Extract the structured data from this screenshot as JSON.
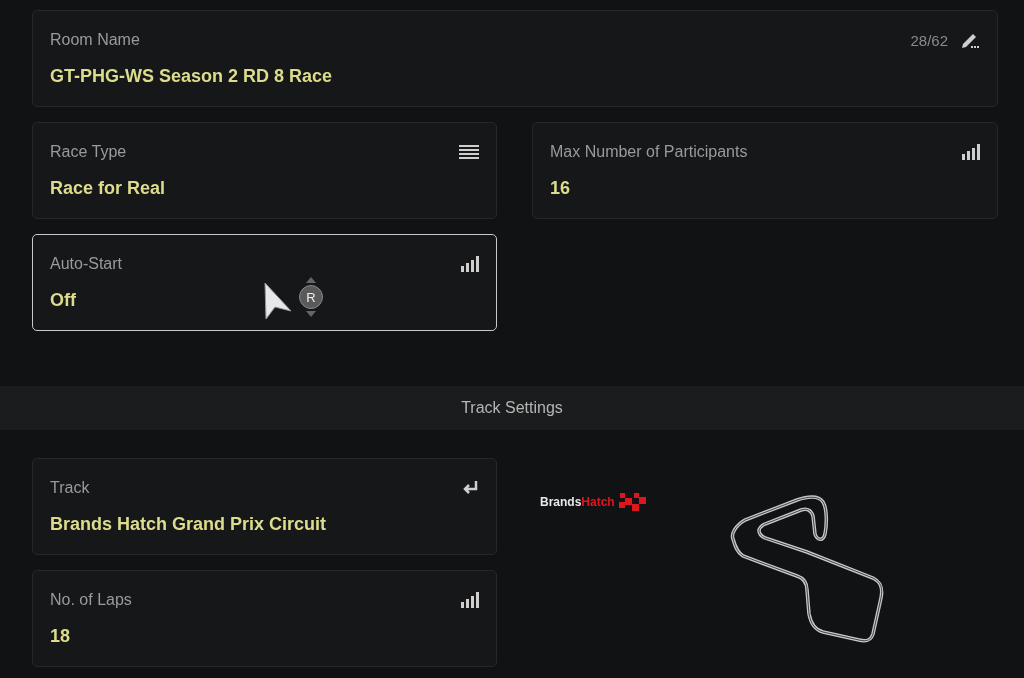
{
  "room_settings": [
    {
      "label": "Room Name",
      "value": "GT-PHG-WS Season 2 RD 8 Race",
      "counter": "28/62",
      "selected": false
    },
    {
      "label": "Race Type",
      "value": "Race for Real",
      "selected": false
    },
    {
      "label": "Max Number of Participants",
      "value": "16",
      "selected": false
    },
    {
      "label": "Auto-Start",
      "value": "Off",
      "selected": true
    }
  ],
  "button_hint": "R",
  "section_title": "Track Settings",
  "track_settings": [
    {
      "label": "Track",
      "value": "Brands Hatch Grand Prix Circuit",
      "selected": false
    },
    {
      "label": "No. of Laps",
      "value": "18",
      "selected": false
    }
  ],
  "track_logo": {
    "word_1": "Brands",
    "word_2": "Hatch"
  }
}
